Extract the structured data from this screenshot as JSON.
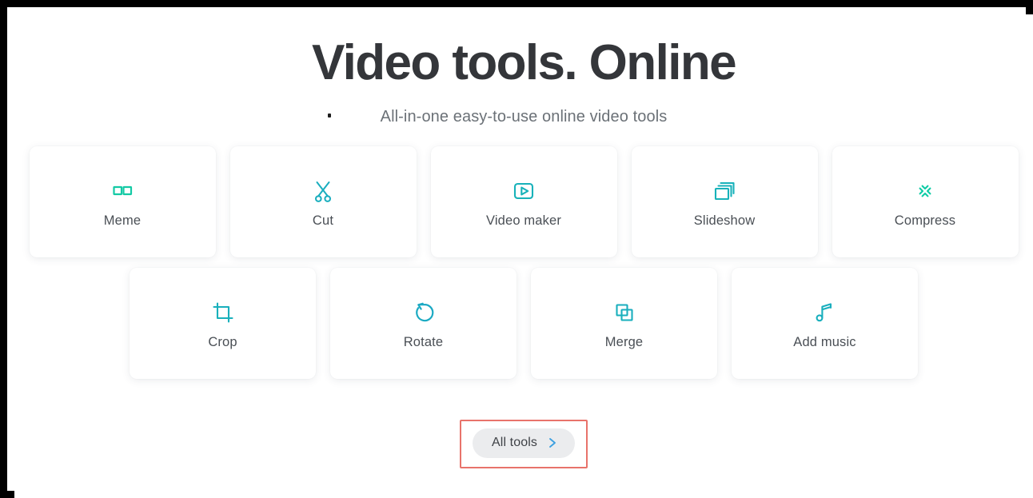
{
  "page": {
    "title": "Video tools. Online",
    "subtitle": "All-in-one easy-to-use online video tools"
  },
  "colors": {
    "heading": "#34363a",
    "subtitle": "#6b7177",
    "icon_gradient_start": "#2196d8",
    "icon_gradient_end": "#0fcf9a",
    "label": "#4a4f55",
    "button_bg": "#ebecee",
    "highlight_border": "#e8736b",
    "chevron": "#3b9fe0"
  },
  "tools": {
    "row1": [
      {
        "label": "Meme",
        "icon": "meme-glasses-icon"
      },
      {
        "label": "Cut",
        "icon": "scissors-icon"
      },
      {
        "label": "Video maker",
        "icon": "play-in-frame-icon"
      },
      {
        "label": "Slideshow",
        "icon": "stacked-frames-icon"
      },
      {
        "label": "Compress",
        "icon": "compress-arrows-icon"
      }
    ],
    "row2": [
      {
        "label": "Crop",
        "icon": "crop-icon"
      },
      {
        "label": "Rotate",
        "icon": "rotate-ccw-icon"
      },
      {
        "label": "Merge",
        "icon": "overlapping-squares-icon"
      },
      {
        "label": "Add music",
        "icon": "music-note-plus-icon"
      }
    ]
  },
  "all_tools_button": {
    "label": "All tools",
    "chevron_icon": "chevron-right-icon"
  }
}
